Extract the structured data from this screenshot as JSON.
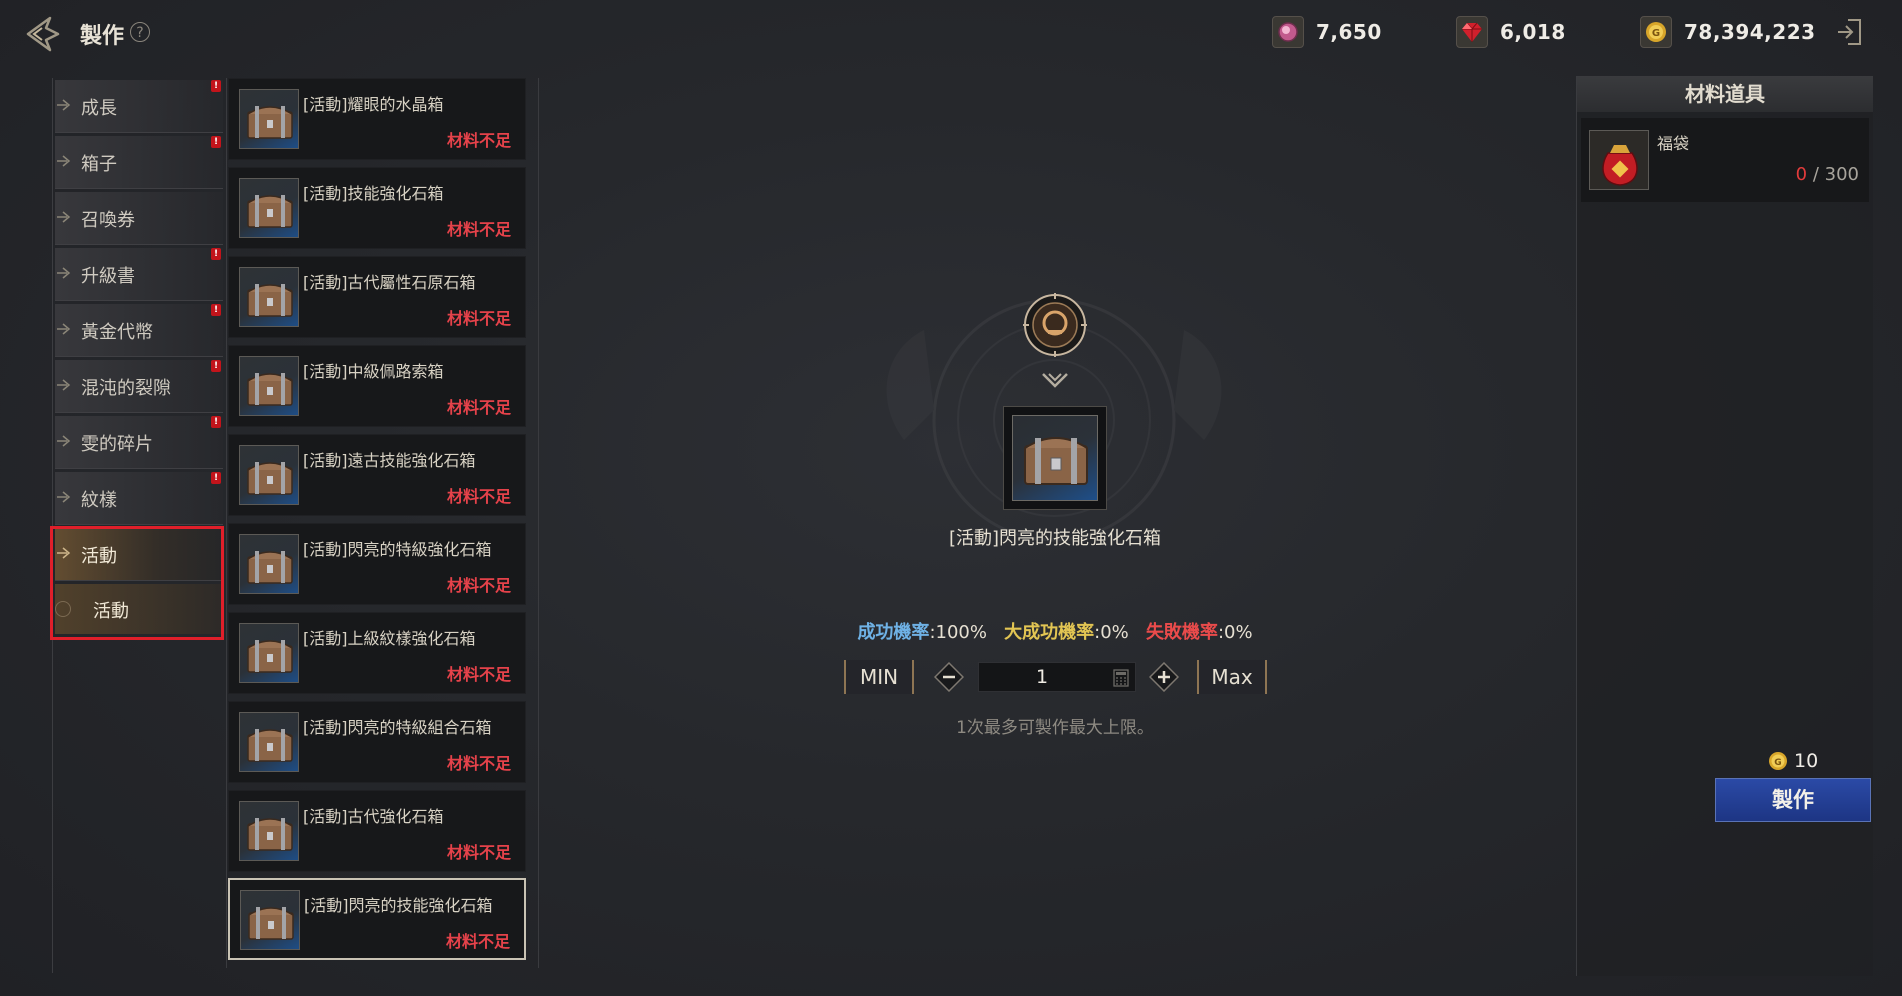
{
  "header": {
    "title": "製作",
    "help_glyph": "?",
    "currencies": [
      {
        "icon": "pink-gem-icon",
        "value": "7,650"
      },
      {
        "icon": "red-ruby-icon",
        "value": "6,018"
      },
      {
        "icon": "gold-coin-icon",
        "value": "78,394,223"
      }
    ]
  },
  "categories": [
    {
      "label": "成長",
      "alert": true
    },
    {
      "label": "箱子",
      "alert": true
    },
    {
      "label": "召喚券",
      "alert": false
    },
    {
      "label": "升級書",
      "alert": true
    },
    {
      "label": "黃金代幣",
      "alert": true
    },
    {
      "label": "混沌的裂隙",
      "alert": true
    },
    {
      "label": "雯的碎片",
      "alert": true
    },
    {
      "label": "紋樣",
      "alert": true
    },
    {
      "label": "活動",
      "alert": false,
      "active": true
    }
  ],
  "alert_glyph": "!",
  "subcategory": {
    "label": "活動"
  },
  "recipes": [
    {
      "name": "[活動]耀眼的水晶箱",
      "status": "材料不足"
    },
    {
      "name": "[活動]技能強化石箱",
      "status": "材料不足"
    },
    {
      "name": "[活動]古代屬性石原石箱",
      "status": "材料不足"
    },
    {
      "name": "[活動]中級佩路索箱",
      "status": "材料不足"
    },
    {
      "name": "[活動]遠古技能強化石箱",
      "status": "材料不足"
    },
    {
      "name": "[活動]閃亮的特級強化石箱",
      "status": "材料不足"
    },
    {
      "name": "[活動]上級紋樣強化石箱",
      "status": "材料不足"
    },
    {
      "name": "[活動]閃亮的特級組合石箱",
      "status": "材料不足"
    },
    {
      "name": "[活動]古代強化石箱",
      "status": "材料不足"
    },
    {
      "name": "[活動]閃亮的技能強化石箱",
      "status": "材料不足",
      "selected": true
    }
  ],
  "detail": {
    "result_name": "[活動]閃亮的技能強化石箱",
    "success_label": "成功機率",
    "success_value": ":100%",
    "great_label": "大成功機率",
    "great_value": ":0%",
    "fail_label": "失敗機率",
    "fail_value": ":0%",
    "min_label": "MIN",
    "max_label": "Max",
    "quantity": "1",
    "hint": "1次最多可製作最大上限。"
  },
  "materials": {
    "header": "材料道具",
    "items": [
      {
        "name": "福袋",
        "have": "0",
        "sep": " / ",
        "need": "300"
      }
    ]
  },
  "craft": {
    "cost": "10",
    "button_label": "製作"
  },
  "colors": {
    "accent_gold": "#8e7553",
    "alert_red": "#c2141b",
    "status_red": "#e5424a",
    "craft_blue": "#2b4aa6",
    "success_blue": "#6fb2e6",
    "great_yellow": "#e2c553",
    "fail_red": "#ea4b4b"
  }
}
